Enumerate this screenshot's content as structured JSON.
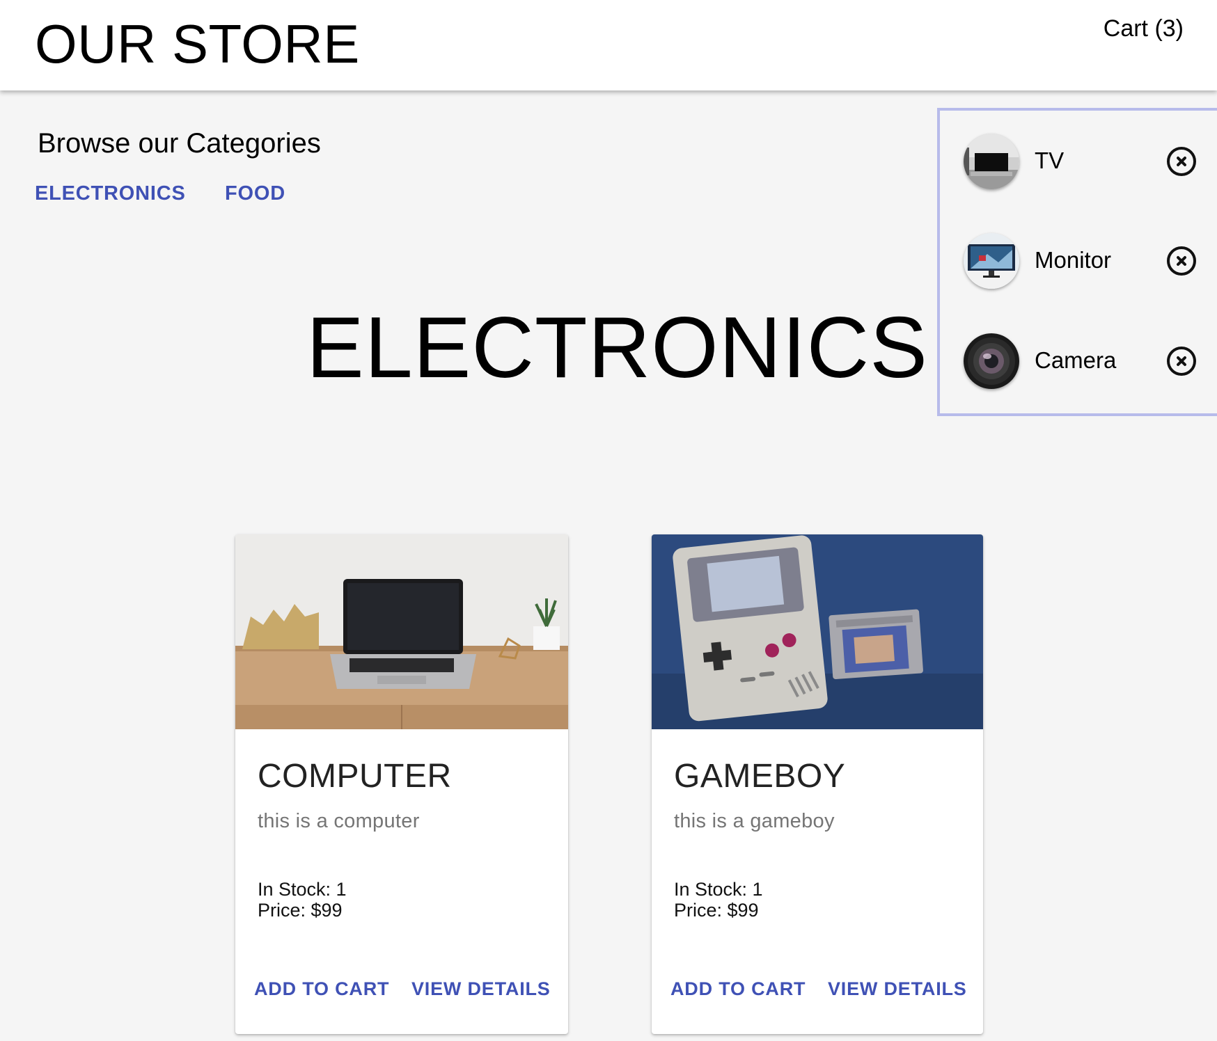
{
  "header": {
    "store_title": "OUR STORE",
    "cart_label": "Cart (3)"
  },
  "categories": {
    "heading": "Browse our Categories",
    "items": [
      {
        "label": "ELECTRONICS"
      },
      {
        "label": "FOOD"
      }
    ]
  },
  "section_title": "ELECTRONICS",
  "cart_dropdown": {
    "items": [
      {
        "name": "TV",
        "thumb_icon": "tv-thumbnail"
      },
      {
        "name": "Monitor",
        "thumb_icon": "monitor-thumbnail"
      },
      {
        "name": "Camera",
        "thumb_icon": "camera-lens-thumbnail"
      }
    ],
    "remove_icon": "close-circle-icon"
  },
  "products": [
    {
      "title": "COMPUTER",
      "description": "this is a computer",
      "stock": "In Stock: 1",
      "price": "Price: $99",
      "add_label": "ADD TO CART",
      "view_label": "VIEW DETAILS"
    },
    {
      "title": "GAMEBOY",
      "description": "this is a gameboy",
      "stock": "In Stock: 1",
      "price": "Price: $99",
      "add_label": "ADD TO CART",
      "view_label": "VIEW DETAILS"
    }
  ],
  "colors": {
    "accent": "#3f51b5",
    "background": "#f5f5f5",
    "cart_panel_border": "#b7bbea"
  }
}
